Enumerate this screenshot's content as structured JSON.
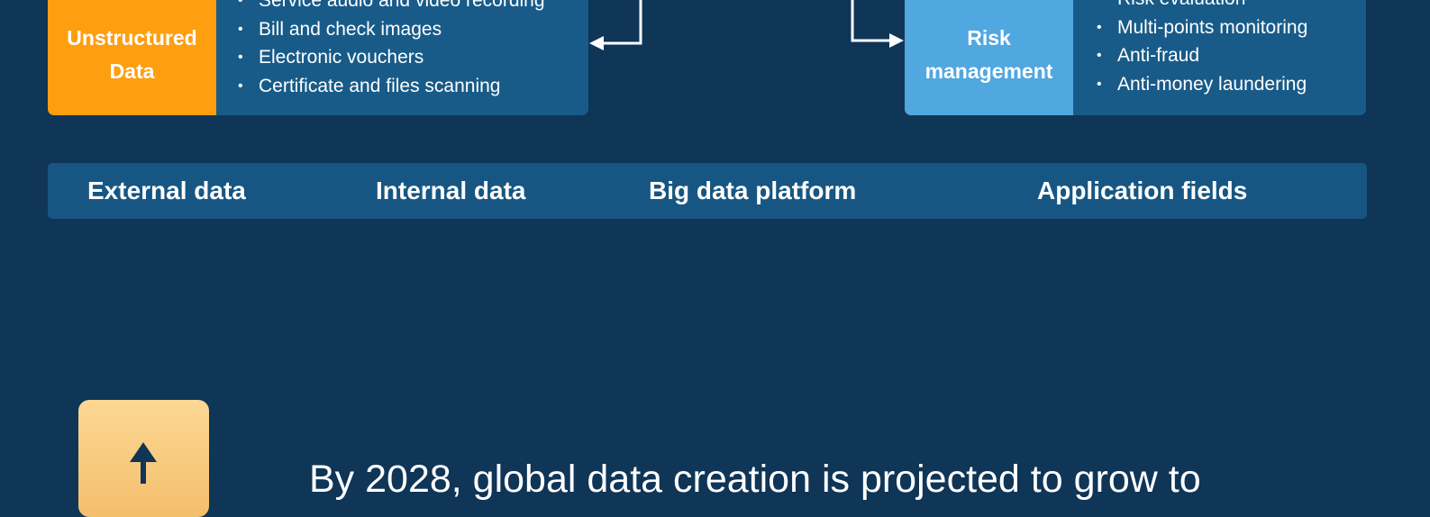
{
  "unstructured_card": {
    "tag": "Unstructured Data",
    "items": [
      "Service audio and video recording",
      "Bill and check images",
      "Electronic vouchers",
      "Certificate and files scanning"
    ]
  },
  "risk_card": {
    "tag": "Risk management",
    "items": [
      "Risk evaluation",
      "Multi-points monitoring",
      "Anti-fraud",
      "Anti-money laundering"
    ]
  },
  "label_bar": {
    "external": "External data",
    "internal": "Internal data",
    "platform": "Big data platform",
    "fields": "Application fields"
  },
  "stat": {
    "text": "By 2028, global data creation is projected to grow to"
  },
  "icons": {
    "growth": "arrow-up-icon",
    "connector": "arrow-connector-icon"
  },
  "colors": {
    "background": "#0f3557",
    "unstructured_tag": "#ff9e0f",
    "risk_tag": "#51a7e0",
    "card_body": "#185b89",
    "label_bar": "#175682",
    "icon_box": "#f7c876"
  }
}
